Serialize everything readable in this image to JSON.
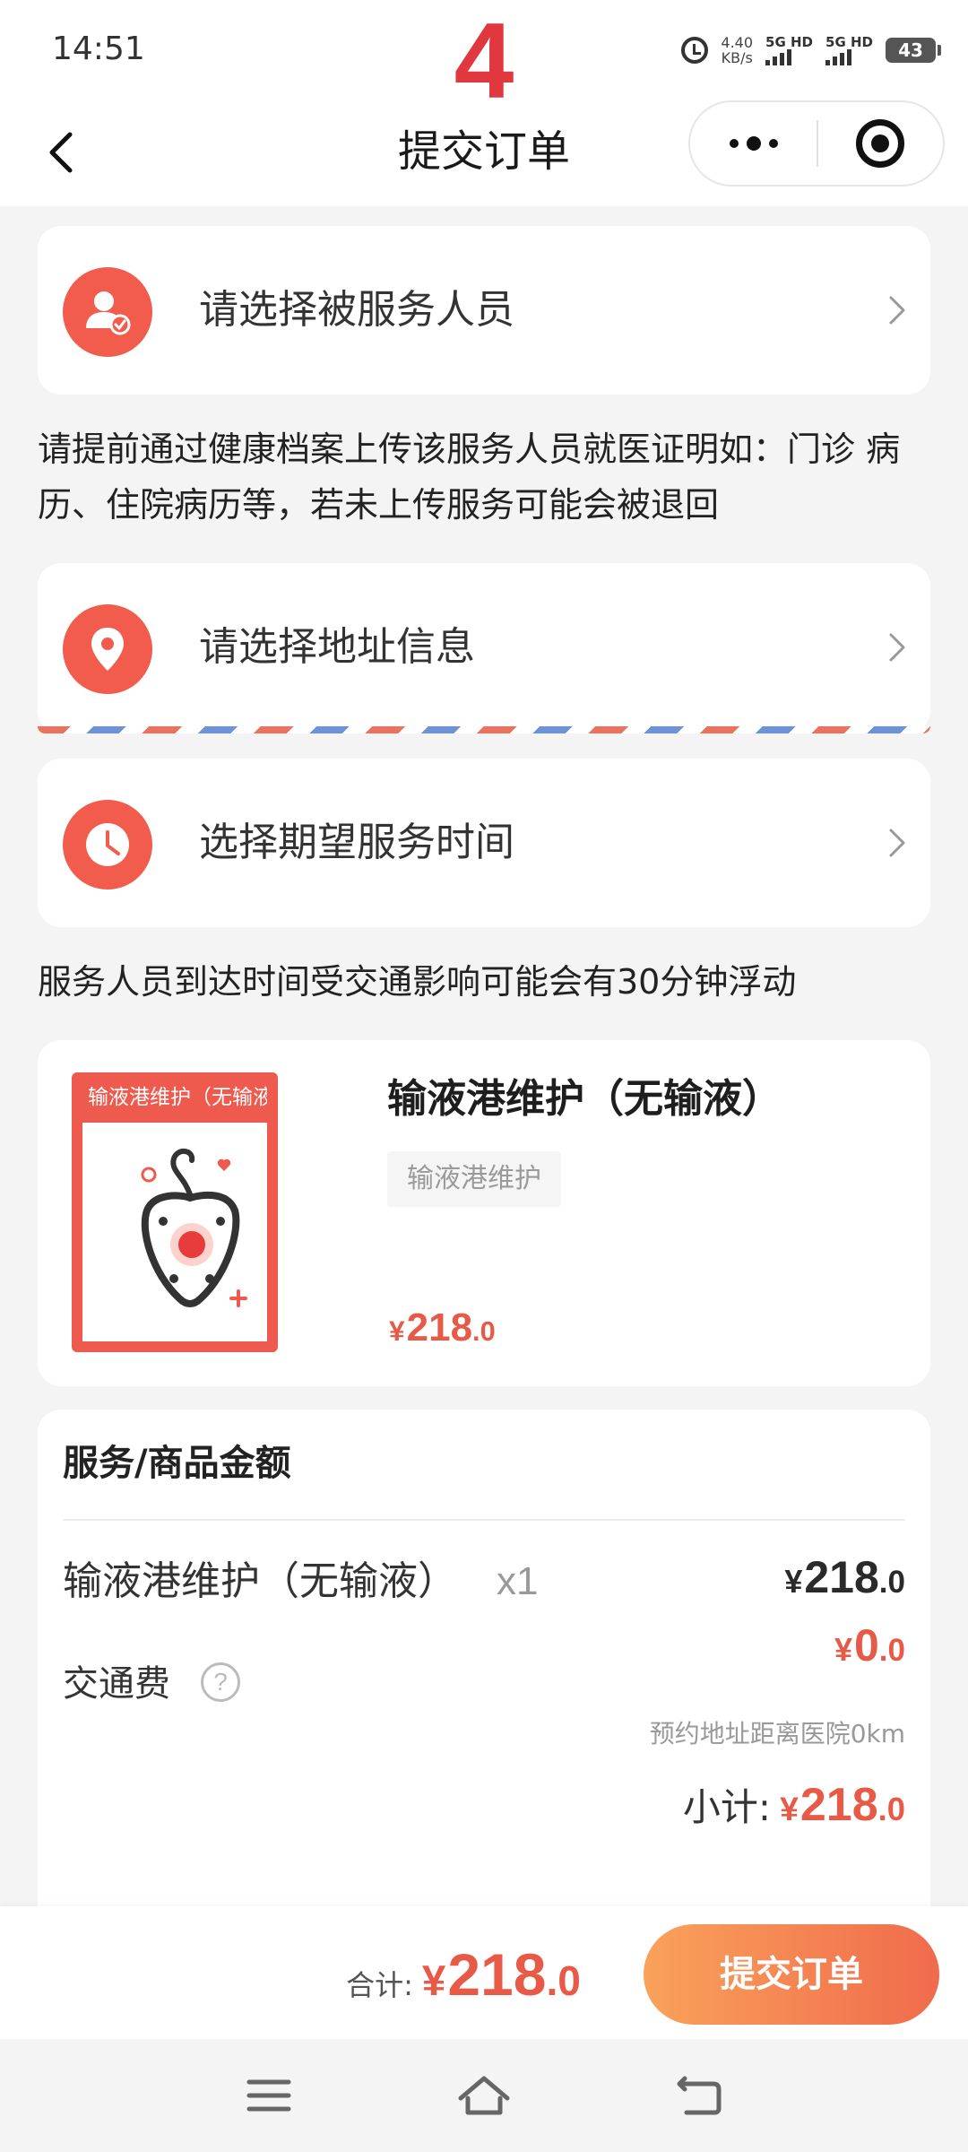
{
  "status_bar": {
    "time": "14:51",
    "speed_value": "4.40",
    "speed_unit": "KB/s",
    "sim1": "5G HD",
    "sim2": "5G HD",
    "battery": "43"
  },
  "step_label": "4",
  "nav": {
    "title": "提交订单",
    "back_icon": "chevron-left-icon",
    "more_icon": "more-dots-icon",
    "close_icon": "target-close-icon"
  },
  "recipient_row": {
    "label": "请选择被服务人员",
    "icon": "person-check-icon"
  },
  "recipient_note": "请提前通过健康档案上传该服务人员就医证明如：门诊 病历、住院病历等，若未上传服务可能会被退回",
  "address_row": {
    "label": "请选择地址信息",
    "icon": "location-pin-icon"
  },
  "time_row": {
    "label": "选择期望服务时间",
    "icon": "clock-icon"
  },
  "time_note": "服务人员到达时间受交通影响可能会有30分钟浮动",
  "product": {
    "tag": "输液港维护（无输液）",
    "name": "输液港维护（无输液）",
    "chip": "输液港维护",
    "price_currency": "¥",
    "price_int": "218",
    "price_dec": ".0"
  },
  "summary": {
    "title": "服务/商品金额",
    "item_name": "输液港维护（无输液）",
    "item_qty": "x1",
    "item_price_currency": "¥",
    "item_price_int": "218",
    "item_price_dec": ".0",
    "traffic_label": "交通费",
    "help_mark": "?",
    "traffic_price_currency": "¥",
    "traffic_price_int": "0",
    "traffic_price_dec": ".0",
    "traffic_note": "预约地址距离医院0km",
    "subtotal_label": "小计:",
    "subtotal_currency": "¥",
    "subtotal_int": "218",
    "subtotal_dec": ".0"
  },
  "footer": {
    "total_label": "合计:",
    "total_currency": "¥",
    "total_int": "218",
    "total_dec": ".0",
    "submit_label": "提交订单"
  },
  "system_nav": {
    "menu_icon": "menu-icon",
    "home_icon": "home-icon",
    "back_icon": "return-icon"
  },
  "colors": {
    "accent": "#f25c4d",
    "price": "#e85a48",
    "button_start": "#f9a25a",
    "button_end": "#f06b4d",
    "step": "#e0383e"
  }
}
